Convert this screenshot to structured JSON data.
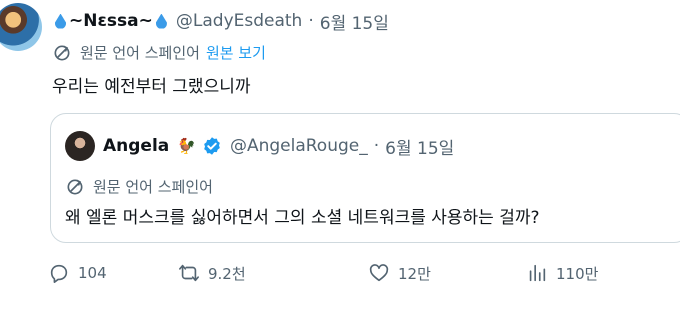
{
  "tweet": {
    "display_name": "~Nεssa~",
    "handle": "@LadyEsdeath",
    "separator": "·",
    "date": "6월 15일",
    "translate_note": "원문 언어 스페인어",
    "translate_link": "원본 보기",
    "text": "우리는 예전부터 그랬으니까"
  },
  "quote": {
    "display_name": "Angela",
    "handle": "@AngelaRouge_",
    "separator": "·",
    "date": "6월 15일",
    "translate_note": "원문 언어 스페인어",
    "text": "왜 엘론 머스크를 싫어하면서 그의 소셜 네트워크를 사용하는 걸까?"
  },
  "actions": {
    "replies": "104",
    "reposts": "9.2천",
    "likes": "12만",
    "views": "110만"
  },
  "colors": {
    "accent": "#1d9bf0",
    "secondary_text": "#536471",
    "primary_text": "#0f1419",
    "border": "#cfd9de"
  },
  "icons": [
    "water-drop-icon",
    "translate-icon",
    "chick-emoji-icon",
    "verified-badge-icon",
    "reply-icon",
    "repost-icon",
    "like-icon",
    "views-icon"
  ]
}
